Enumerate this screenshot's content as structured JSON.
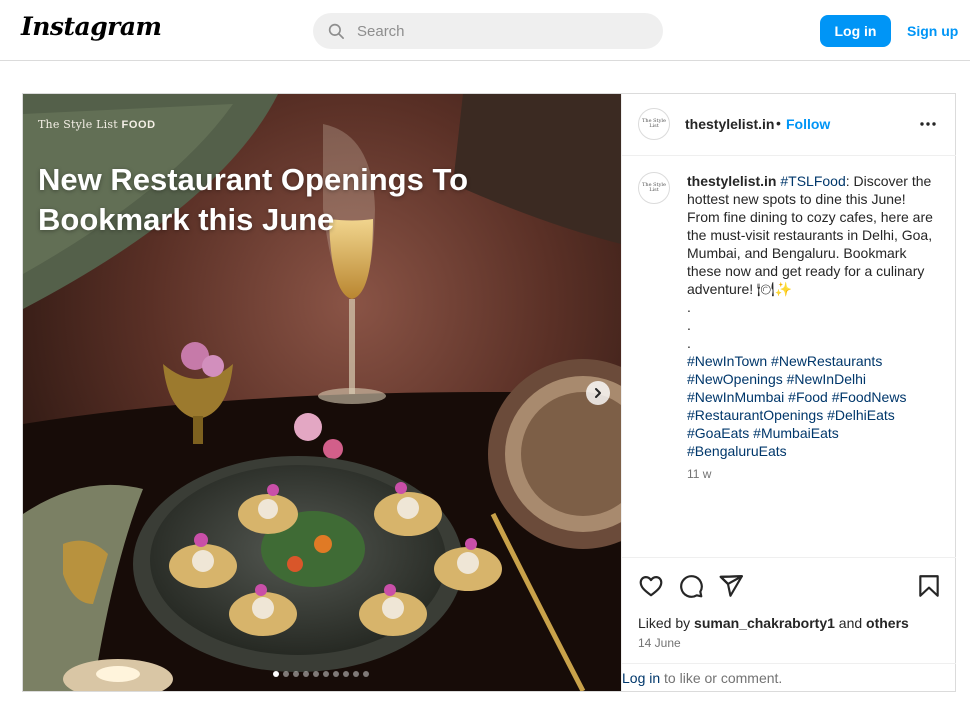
{
  "header": {
    "logo": "Instagram",
    "search_placeholder": "Search",
    "login_label": "Log in",
    "signup_label": "Sign up"
  },
  "post": {
    "username": "thestylelist.in",
    "separator": "•",
    "follow_label": "Follow",
    "avatar_text": "The Style List",
    "media": {
      "brand_serif": "The Style List",
      "brand_bold": "FOOD",
      "headline": "New Restaurant Openings To Bookmark this June",
      "carousel_count": 10,
      "carousel_active": 1
    },
    "caption": {
      "username": "thestylelist.in",
      "hashtag": "#TSLFood",
      "text": ": Discover the hottest new spots to dine this June! From fine dining to cozy cafes, here are the must-visit restaurants in Delhi, Goa, Mumbai, and Bengaluru. Bookmark these now and get ready for a culinary adventure! 🍽✨",
      "dots": [
        ".",
        ".",
        "."
      ],
      "hashtags": "#NewInTown #NewRestaurants #NewOpenings #NewInDelhi #NewInMumbai #Food #FoodNews #RestaurantOpenings #DelhiEats #GoaEats #MumbaiEats #BengaluruEats"
    },
    "time_ago": "11 w",
    "liked_by_prefix": "Liked by",
    "liked_by_user": "suman_chakraborty1",
    "liked_by_and": "and",
    "liked_by_others": "others",
    "date": "14 June",
    "login_link": "Log in",
    "login_suffix": " to like or comment."
  },
  "colors": {
    "accent": "#0095f6",
    "link": "#00376b",
    "muted": "#737373",
    "border": "#dbdbdb"
  },
  "icons": [
    "search-icon",
    "chevron-right-icon",
    "more-icon",
    "heart-icon",
    "comment-icon",
    "share-icon",
    "bookmark-icon"
  ]
}
